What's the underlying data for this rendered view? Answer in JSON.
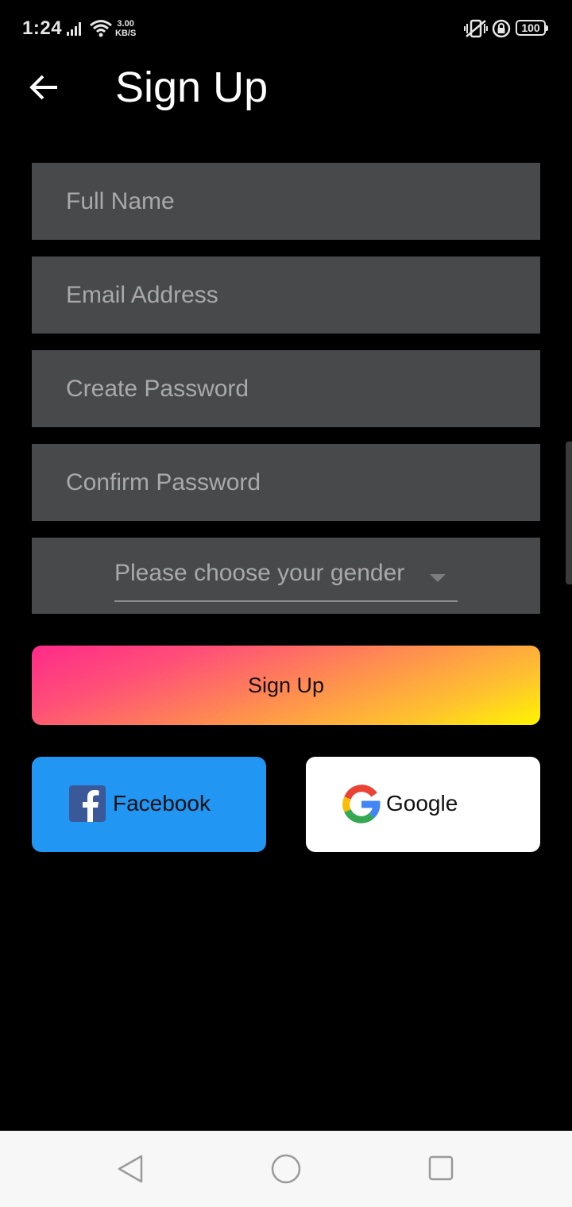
{
  "status_bar": {
    "time": "1:24",
    "net_speed_value": "3.00",
    "net_speed_unit": "KB/S",
    "battery": "100"
  },
  "header": {
    "title": "Sign Up"
  },
  "form": {
    "full_name_placeholder": "Full Name",
    "email_placeholder": "Email Address",
    "password_placeholder": "Create Password",
    "confirm_password_placeholder": "Confirm Password",
    "gender_placeholder": "Please choose your gender"
  },
  "actions": {
    "signup_label": "Sign Up",
    "facebook_label": "Facebook",
    "google_label": "Google"
  },
  "colors": {
    "background": "#000000",
    "field_bg": "#48494b",
    "facebook_bg": "#2196f3",
    "gradient_start": "#ff2a8a",
    "gradient_end": "#fff500"
  },
  "icons": [
    "back-arrow-icon",
    "signal-icon",
    "wifi-icon",
    "vibrate-icon",
    "rotation-lock-icon",
    "battery-icon",
    "dropdown-caret-icon",
    "facebook-icon",
    "google-icon",
    "nav-back-icon",
    "nav-home-icon",
    "nav-recents-icon"
  ]
}
